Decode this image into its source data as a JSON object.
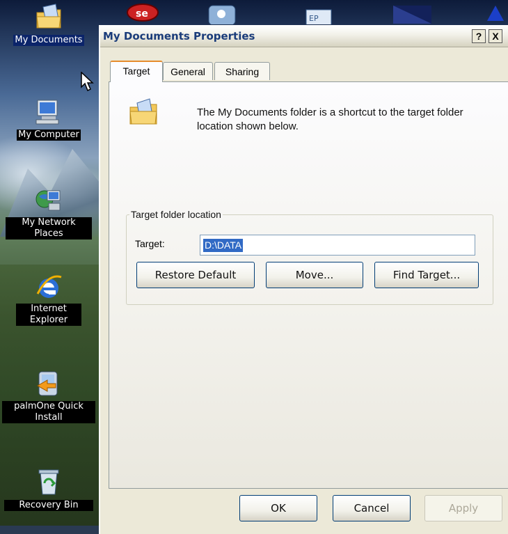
{
  "desktop": {
    "icons": [
      {
        "label": "My Documents",
        "icon": "my-documents-icon"
      },
      {
        "label": "My Computer",
        "icon": "my-computer-icon"
      },
      {
        "label": "My Network Places",
        "icon": "network-places-icon"
      },
      {
        "label": "Internet Explorer",
        "icon": "internet-explorer-icon"
      },
      {
        "label": "palmOne Quick Install",
        "icon": "palm-install-icon"
      },
      {
        "label": "Recovery Bin",
        "icon": "recycle-bin-icon"
      }
    ]
  },
  "dialog": {
    "title": "My Documents Properties",
    "help_label": "?",
    "close_label": "X",
    "tabs": [
      {
        "label": "Target",
        "active": true
      },
      {
        "label": "General",
        "active": false
      },
      {
        "label": "Sharing",
        "active": false
      }
    ],
    "info": "The My Documents folder is a shortcut to the target folder location shown below.",
    "group_legend": "Target folder location",
    "target_label": "Target:",
    "target_value": "D:\\DATA",
    "buttons": {
      "restore": "Restore Default",
      "move": "Move...",
      "find": "Find Target..."
    },
    "footer": {
      "ok": "OK",
      "cancel": "Cancel",
      "apply": "Apply"
    }
  },
  "colors": {
    "selection": "#316ac5",
    "dialog_bg": "#ece9d8",
    "title_text": "#1a3c7a"
  }
}
